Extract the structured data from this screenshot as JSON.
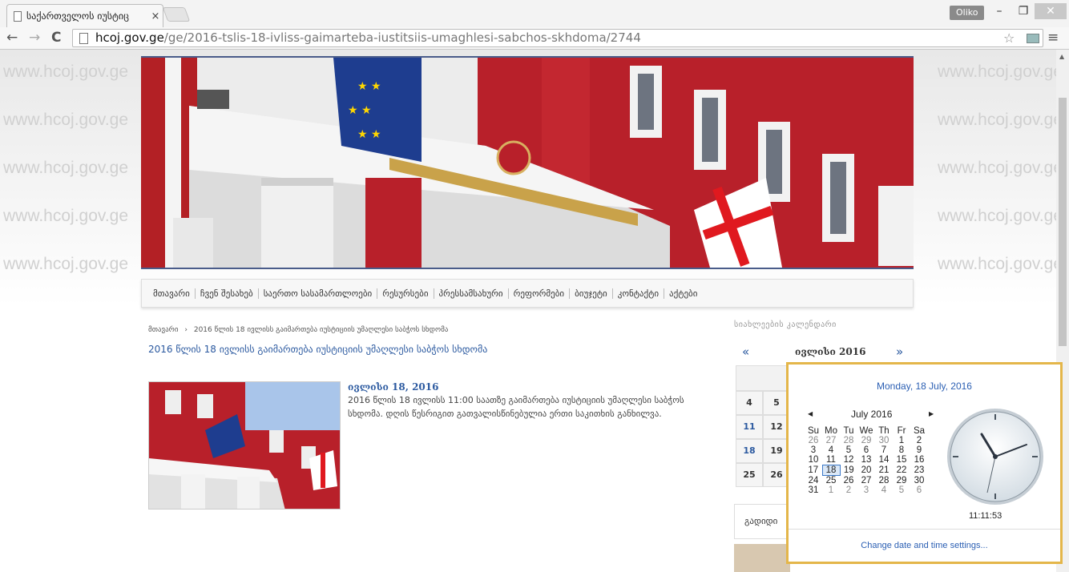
{
  "browser": {
    "tab_title": "საქართველოს იუსტიც",
    "tab_close": "×",
    "profile": "Oliko",
    "url_host": "hcoj.gov.ge",
    "url_path": "/ge/2016-tslis-18-ivliss-gaimarteba-iustitsiis-umaghlesi-sabchos-skhdoma/2744"
  },
  "watermark_text": "www.hcoj.gov.ge",
  "nav": {
    "items": [
      "მთავარი",
      "ჩვენ შესახებ",
      "საერთო სასამართლოები",
      "რესურსები",
      "პრესსამსახური",
      "რეფორმები",
      "ბიუჯეტი",
      "კონტაქტი",
      "აქტები"
    ]
  },
  "breadcrumb": {
    "home": "მთავარი",
    "sep": "›",
    "current": "2016 წლის 18 ივლისს გაიმართება იუსტიციის უმაღლესი საბჭოს სხდომა"
  },
  "page_title": "2016 წლის 18 ივლისს გაიმართება იუსტიციის უმაღლესი საბჭოს სხდომა",
  "article": {
    "date": "ივლისი 18, 2016",
    "text": "2016 წლის 18 ივლისს 11:00 საათზე გაიმართება იუსტიციის უმაღლესი საბჭოს სხდომა. დღის წესრიგით გათვალისწინებულია ერთი საკითხის განხილვა."
  },
  "sidebar": {
    "calendar_heading": "სიახლეების კალენდარი",
    "prev": "«",
    "month": "ივლისი 2016",
    "next": "»",
    "rows": [
      [
        "4",
        "5"
      ],
      [
        "11",
        "12"
      ],
      [
        "18",
        "19"
      ],
      [
        "25",
        "26"
      ]
    ],
    "linked": [
      "11",
      "18"
    ],
    "box_label": "გადიდი"
  },
  "clock_popup": {
    "full_date": "Monday, 18 July, 2016",
    "month_label": "July 2016",
    "prev": "◀",
    "next": "▶",
    "weekdays": [
      "Su",
      "Mo",
      "Tu",
      "We",
      "Th",
      "Fr",
      "Sa"
    ],
    "weeks": [
      [
        "26",
        "27",
        "28",
        "29",
        "30",
        "1",
        "2"
      ],
      [
        "3",
        "4",
        "5",
        "6",
        "7",
        "8",
        "9"
      ],
      [
        "10",
        "11",
        "12",
        "13",
        "14",
        "15",
        "16"
      ],
      [
        "17",
        "18",
        "19",
        "20",
        "21",
        "22",
        "23"
      ],
      [
        "24",
        "25",
        "26",
        "27",
        "28",
        "29",
        "30"
      ],
      [
        "31",
        "1",
        "2",
        "3",
        "4",
        "5",
        "6"
      ]
    ],
    "selected_day": "18",
    "time": "11:11:53",
    "footer_link": "Change date and time settings..."
  }
}
